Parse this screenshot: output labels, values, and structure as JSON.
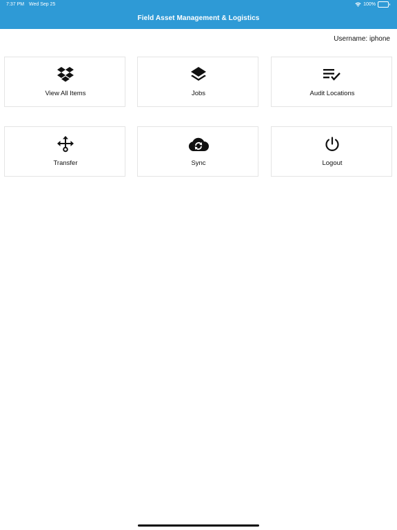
{
  "status_bar": {
    "time": "7:37 PM",
    "date": "Wed Sep 25",
    "battery": "100%",
    "wifi_icon": "wifi-icon",
    "battery_icon": "battery-icon"
  },
  "header": {
    "title": "Field Asset Management & Logistics",
    "background": "#2e9ad6"
  },
  "user": {
    "label": "Username: iphone"
  },
  "tiles": [
    {
      "label": "View All Items",
      "icon": "dropbox-icon"
    },
    {
      "label": "Jobs",
      "icon": "layers-icon"
    },
    {
      "label": "Audit Locations",
      "icon": "playlist-check-icon"
    },
    {
      "label": "Transfer",
      "icon": "transfer-arrows-icon"
    },
    {
      "label": "Sync",
      "icon": "cloud-sync-icon"
    },
    {
      "label": "Logout",
      "icon": "power-icon"
    }
  ]
}
